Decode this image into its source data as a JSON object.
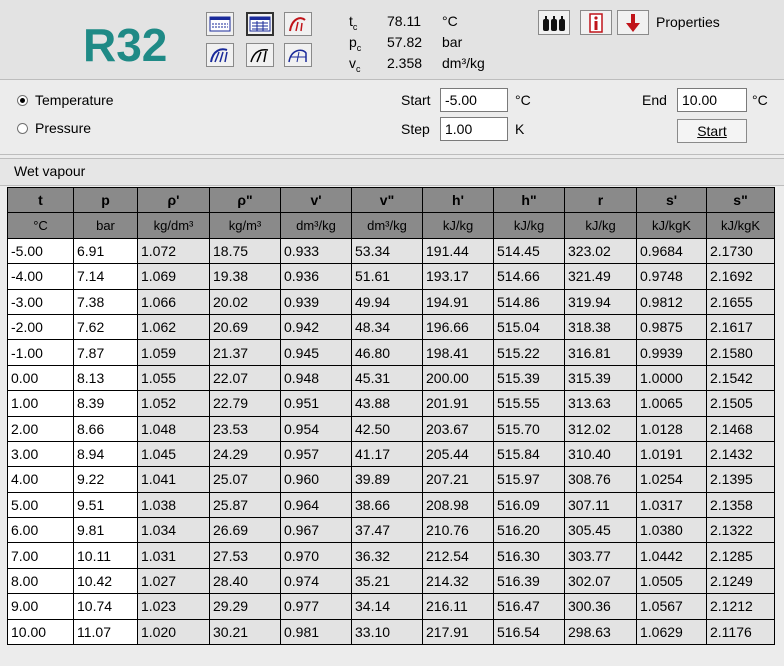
{
  "refrigerant": "R32",
  "toolbar": {
    "row1": [
      {
        "icon": "table-small-icon"
      },
      {
        "icon": "table-icon"
      },
      {
        "icon": "curve-red-icon"
      }
    ],
    "row2": [
      {
        "icon": "diagram-blue-icon"
      },
      {
        "icon": "diagram-icon"
      },
      {
        "icon": "diagram-outline-icon"
      }
    ],
    "right": [
      {
        "icon": "cylinders-icon"
      },
      {
        "icon": "info-icon"
      },
      {
        "icon": "down-arrow-icon"
      }
    ],
    "properties_label": "Properties"
  },
  "critical": [
    {
      "sym": "t",
      "sub": "c",
      "value": "78.11",
      "unit": "°C"
    },
    {
      "sym": "p",
      "sub": "c",
      "value": "57.82",
      "unit": "bar"
    },
    {
      "sym": "v",
      "sub": "c",
      "value": "2.358",
      "unit": "dm³/kg"
    }
  ],
  "controls": {
    "temperature_label": "Temperature",
    "pressure_label": "Pressure",
    "selected": "temperature",
    "start_label": "Start",
    "start_value": "-5.00",
    "start_unit": "°C",
    "step_label": "Step",
    "step_value": "1.00",
    "step_unit": "K",
    "end_label": "End",
    "end_value": "10.00",
    "end_unit": "°C",
    "start_button": "Start"
  },
  "section_title": "Wet vapour",
  "table": {
    "headers": [
      "t",
      "p",
      "ρ'",
      "ρ\"",
      "v'",
      "v\"",
      "h'",
      "h\"",
      "r",
      "s'",
      "s\""
    ],
    "units": [
      "°C",
      "bar",
      "kg/dm³",
      "kg/m³",
      "dm³/kg",
      "dm³/kg",
      "kJ/kg",
      "kJ/kg",
      "kJ/kg",
      "kJ/kgK",
      "kJ/kgK"
    ],
    "rows": [
      [
        "-5.00",
        "6.91",
        "1.072",
        "18.75",
        "0.933",
        "53.34",
        "191.44",
        "514.45",
        "323.02",
        "0.9684",
        "2.1730"
      ],
      [
        "-4.00",
        "7.14",
        "1.069",
        "19.38",
        "0.936",
        "51.61",
        "193.17",
        "514.66",
        "321.49",
        "0.9748",
        "2.1692"
      ],
      [
        "-3.00",
        "7.38",
        "1.066",
        "20.02",
        "0.939",
        "49.94",
        "194.91",
        "514.86",
        "319.94",
        "0.9812",
        "2.1655"
      ],
      [
        "-2.00",
        "7.62",
        "1.062",
        "20.69",
        "0.942",
        "48.34",
        "196.66",
        "515.04",
        "318.38",
        "0.9875",
        "2.1617"
      ],
      [
        "-1.00",
        "7.87",
        "1.059",
        "21.37",
        "0.945",
        "46.80",
        "198.41",
        "515.22",
        "316.81",
        "0.9939",
        "2.1580"
      ],
      [
        "0.00",
        "8.13",
        "1.055",
        "22.07",
        "0.948",
        "45.31",
        "200.00",
        "515.39",
        "315.39",
        "1.0000",
        "2.1542"
      ],
      [
        "1.00",
        "8.39",
        "1.052",
        "22.79",
        "0.951",
        "43.88",
        "201.91",
        "515.55",
        "313.63",
        "1.0065",
        "2.1505"
      ],
      [
        "2.00",
        "8.66",
        "1.048",
        "23.53",
        "0.954",
        "42.50",
        "203.67",
        "515.70",
        "312.02",
        "1.0128",
        "2.1468"
      ],
      [
        "3.00",
        "8.94",
        "1.045",
        "24.29",
        "0.957",
        "41.17",
        "205.44",
        "515.84",
        "310.40",
        "1.0191",
        "2.1432"
      ],
      [
        "4.00",
        "9.22",
        "1.041",
        "25.07",
        "0.960",
        "39.89",
        "207.21",
        "515.97",
        "308.76",
        "1.0254",
        "2.1395"
      ],
      [
        "5.00",
        "9.51",
        "1.038",
        "25.87",
        "0.964",
        "38.66",
        "208.98",
        "516.09",
        "307.11",
        "1.0317",
        "2.1358"
      ],
      [
        "6.00",
        "9.81",
        "1.034",
        "26.69",
        "0.967",
        "37.47",
        "210.76",
        "516.20",
        "305.45",
        "1.0380",
        "2.1322"
      ],
      [
        "7.00",
        "10.11",
        "1.031",
        "27.53",
        "0.970",
        "36.32",
        "212.54",
        "516.30",
        "303.77",
        "1.0442",
        "2.1285"
      ],
      [
        "8.00",
        "10.42",
        "1.027",
        "28.40",
        "0.974",
        "35.21",
        "214.32",
        "516.39",
        "302.07",
        "1.0505",
        "2.1249"
      ],
      [
        "9.00",
        "10.74",
        "1.023",
        "29.29",
        "0.977",
        "34.14",
        "216.11",
        "516.47",
        "300.36",
        "1.0567",
        "2.1212"
      ],
      [
        "10.00",
        "11.07",
        "1.020",
        "30.21",
        "0.981",
        "33.10",
        "217.91",
        "516.54",
        "298.63",
        "1.0629",
        "2.1176"
      ]
    ]
  }
}
